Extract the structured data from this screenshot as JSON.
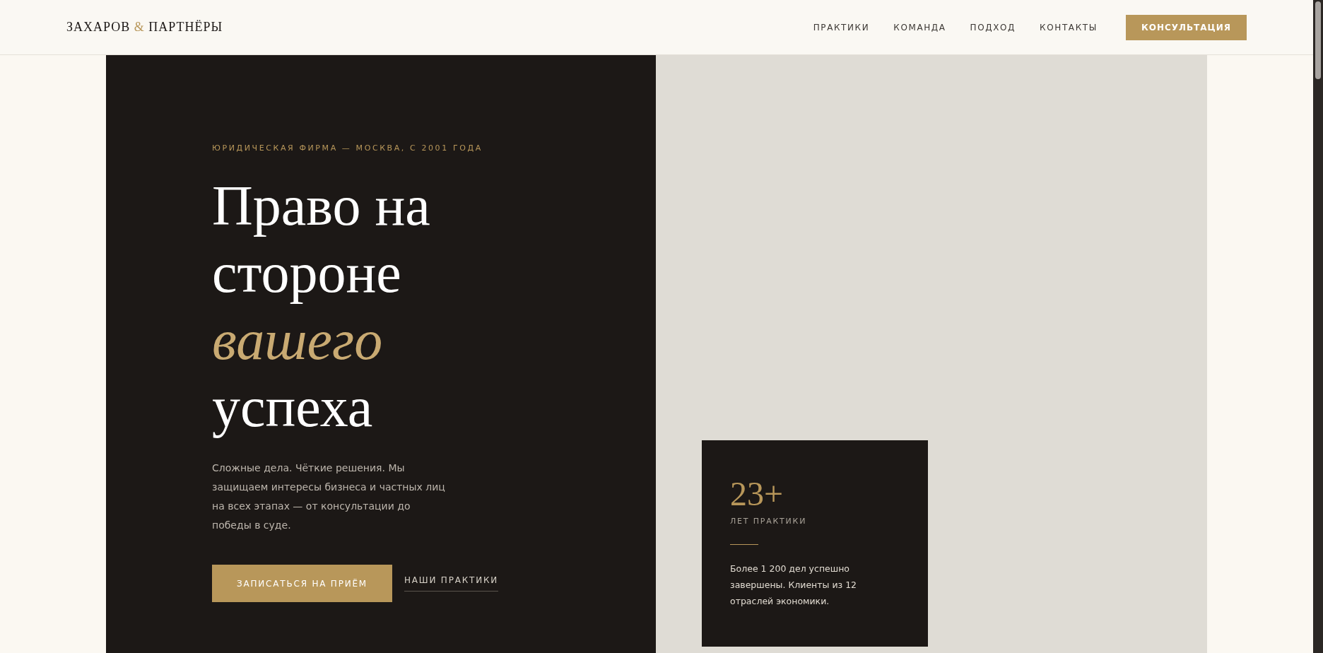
{
  "header": {
    "logo": "ЗАХАРОВ **&** ПАРТНЁРЫ",
    "nav": [
      {
        "label": "ПРАКТИКИ",
        "kind": "link"
      },
      {
        "label": "КОМАНДА",
        "kind": "link"
      },
      {
        "label": "ПОДХОД",
        "kind": "link"
      },
      {
        "label": "КОНТАКТЫ",
        "kind": "link"
      },
      {
        "label": "КОНСУЛЬТАЦИЯ",
        "kind": "button"
      }
    ]
  },
  "hero": {
    "eyebrow": "ЮРИДИЧЕСКАЯ ФИРМА — МОСКВА, С 2001 ГОДА",
    "headline": "Право на стороне *вашего* успеха",
    "lead": "Сложные дела. Чёткие решения. Мы защищаем интересы бизнеса и частных лиц на всех этапах — от консультации до победы в суде.",
    "actions": [
      {
        "label": "ЗАПИСАТЬСЯ НА ПРИЁМ",
        "kind": "primary"
      },
      {
        "label": "НАШИ ПРАКТИКИ",
        "kind": "link"
      }
    ]
  },
  "stat_card": {
    "value": "23+",
    "label": "ЛЕТ ПРАКТИКИ",
    "text": "Более 1 200 дел успешно завершены. Клиенты из 12 отраслей экономики."
  }
}
